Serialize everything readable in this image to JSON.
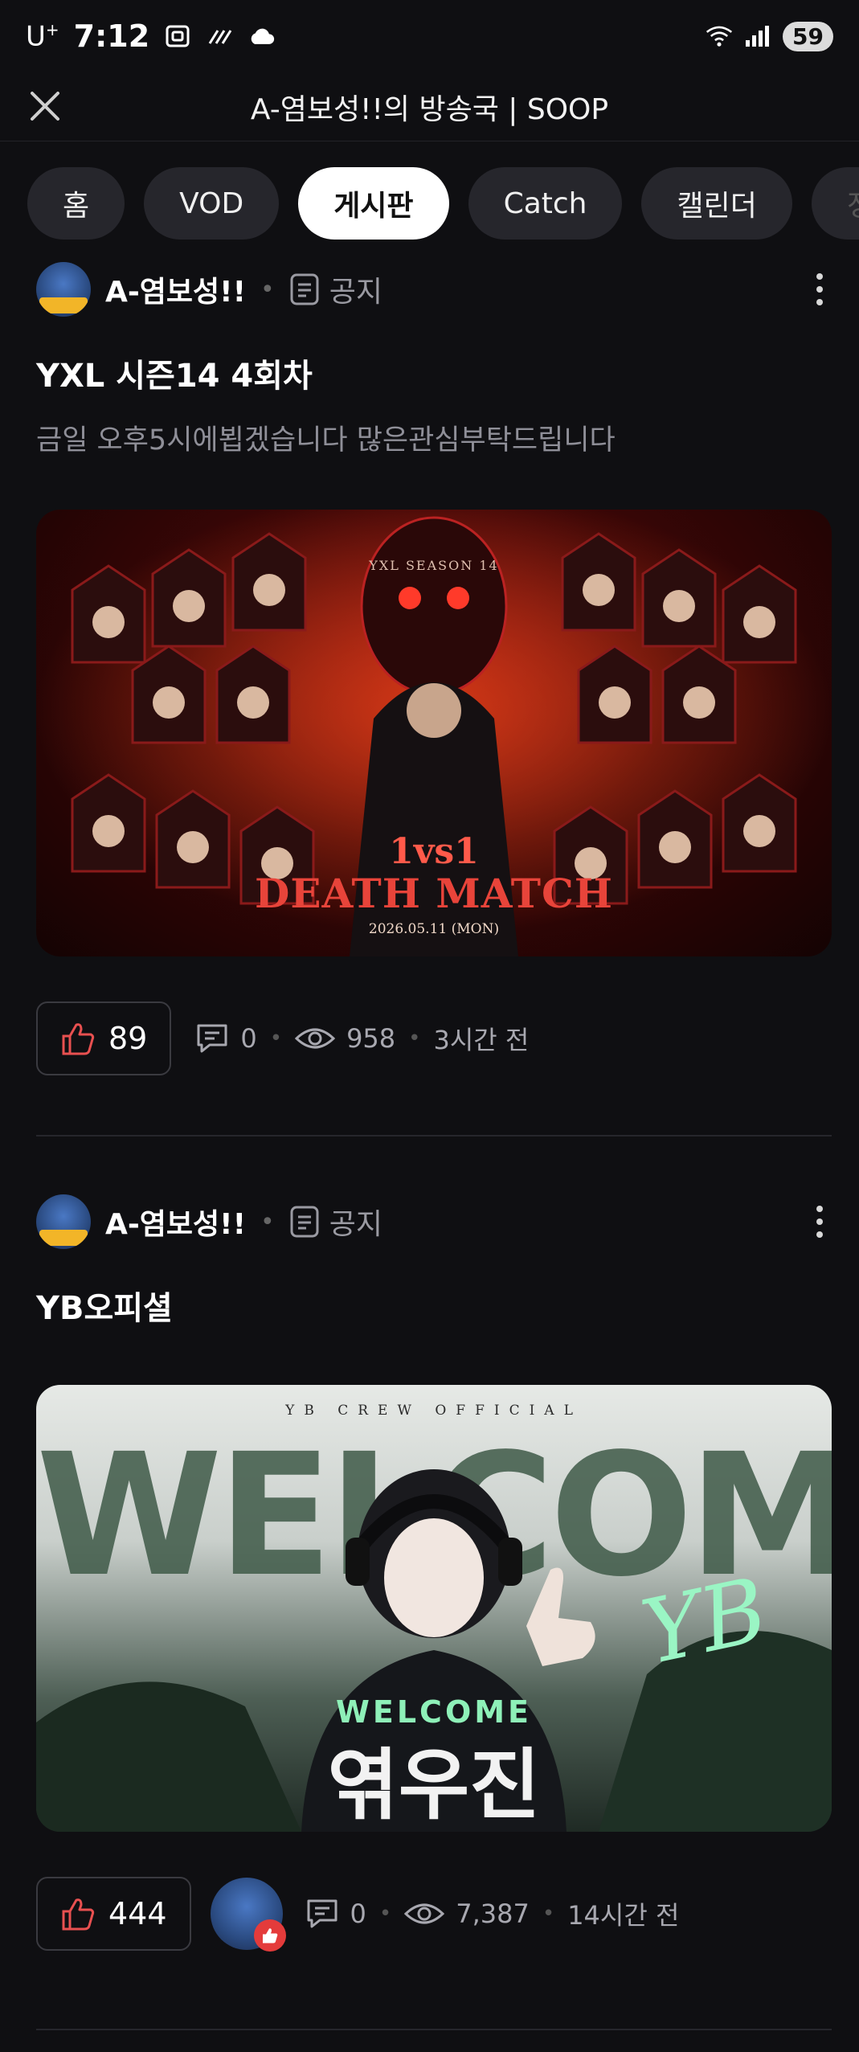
{
  "status_bar": {
    "carrier": "U",
    "carrier_sup": "+",
    "time": "7:12",
    "battery": "59"
  },
  "header": {
    "title": "A-염보성!!의 방송국 | SOOP"
  },
  "tabs": [
    {
      "label": "홈",
      "active": false
    },
    {
      "label": "VOD",
      "active": false
    },
    {
      "label": "게시판",
      "active": true
    },
    {
      "label": "Catch",
      "active": false
    },
    {
      "label": "캘린더",
      "active": false
    },
    {
      "label": "정",
      "active": false
    }
  ],
  "posts": [
    {
      "author": "A-염보성!!",
      "category": "공지",
      "title": "YXL 시즌14 4회차",
      "body": "금일 오후5시에뵙겠습니다 많은관심부탁드립니다",
      "image": {
        "top_text": "YXL SEASON 14",
        "headline": "1vs1",
        "subline": "DEATH MATCH",
        "date": "2026.05.11 (MON)"
      },
      "likes": "89",
      "comments": "0",
      "views": "958",
      "time_ago": "3시간 전"
    },
    {
      "author": "A-염보성!!",
      "category": "공지",
      "title": "YB오피셜",
      "image": {
        "top_text": "YB CREW OFFICIAL",
        "big_text": "WELCOME",
        "sub_text": "WELCOME",
        "name": "엮우진",
        "logo": "YB"
      },
      "likes": "444",
      "comments": "0",
      "views": "7,387",
      "time_ago": "14시간 전"
    }
  ],
  "colors": {
    "background": "#0f0f12",
    "tab_active": "#ffffff",
    "tab_inactive": "#26262c",
    "like_red": "#e85050",
    "muted_text": "#9a9aa2"
  }
}
